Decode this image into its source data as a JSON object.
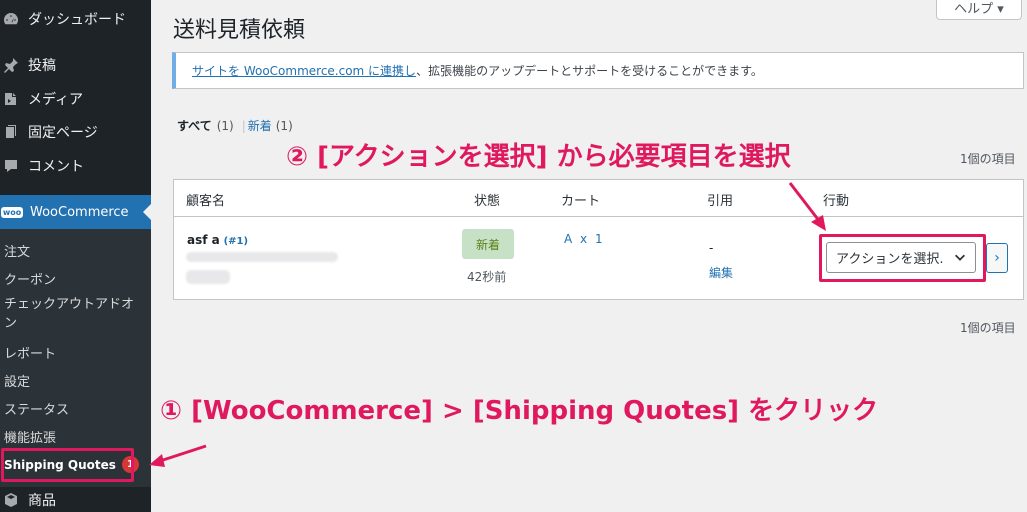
{
  "sidebar": {
    "items": [
      {
        "label": "ダッシュボード",
        "icon": "dashboard-icon"
      },
      {
        "label": "投稿",
        "icon": "pin-icon"
      },
      {
        "label": "メディア",
        "icon": "media-icon"
      },
      {
        "label": "固定ページ",
        "icon": "page-icon"
      },
      {
        "label": "コメント",
        "icon": "comment-icon"
      }
    ],
    "woocommerce": {
      "label": "WooCommerce",
      "icon_text": "woo",
      "icon": "woo-icon"
    },
    "submenu": [
      {
        "label": "注文"
      },
      {
        "label": "クーポン"
      },
      {
        "label": "チェックアウトアドオン"
      },
      {
        "label": "レポート"
      },
      {
        "label": "設定"
      },
      {
        "label": "ステータス"
      },
      {
        "label": "機能拡張"
      }
    ],
    "shipping_quotes": {
      "label": "Shipping Quotes",
      "badge": "1"
    },
    "products": {
      "label": "商品",
      "icon": "box-icon"
    }
  },
  "header": {
    "help_label": "ヘルプ ▾",
    "title": "送料見積依頼"
  },
  "notice": {
    "link_text": "サイトを WooCommerce.com に連携し",
    "text": "、拡張機能のアップデートとサポートを受けることができます。"
  },
  "filters": {
    "all_label": "すべて",
    "all_count": "(1)",
    "separator": "|",
    "new_label": "新着",
    "new_count": "(1)"
  },
  "item_count": "1個の項目",
  "table": {
    "headers": {
      "customer": "顧客名",
      "status": "状態",
      "cart": "カート",
      "quote": "引用",
      "action": "行動"
    },
    "rows": [
      {
        "customer_name": "asf a",
        "customer_id": "(#1)",
        "status": "新着",
        "time_ago": "42秒前",
        "cart": "A x 1",
        "quote": "-",
        "edit_label": "編集",
        "action_select": "アクションを選択.",
        "go_label": "›"
      }
    ]
  },
  "annotations": {
    "step1": "① [WooCommerce] > [Shipping Quotes] をクリック",
    "step2": "② [アクションを選択] から必要項目を選択"
  },
  "colors": {
    "sidebar_bg": "#1d2327",
    "sidebar_active": "#2271b1",
    "link": "#2271b1",
    "highlight": "#e0195e",
    "status_new_bg": "#c6e1c6",
    "status_new_fg": "#5b841b"
  }
}
